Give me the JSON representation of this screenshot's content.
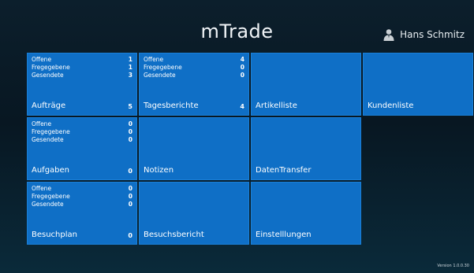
{
  "app": {
    "title": "mTrade",
    "version": "Version 1.0.0.30"
  },
  "user": {
    "name": "Hans Schmitz",
    "icon": "person-icon"
  },
  "tiles": [
    {
      "id": "auftraege",
      "label": "Aufträge",
      "count": "5",
      "stats": [
        {
          "label": "Offene",
          "value": "1"
        },
        {
          "label": "Fregegebene",
          "value": "1"
        },
        {
          "label": "Gesendete",
          "value": "3"
        }
      ]
    },
    {
      "id": "tagesberichte",
      "label": "Tagesberichte",
      "count": "4",
      "stats": [
        {
          "label": "Offene",
          "value": "4"
        },
        {
          "label": "Fregegebene",
          "value": "0"
        },
        {
          "label": "Gesendete",
          "value": "0"
        }
      ]
    },
    {
      "id": "artikelliste",
      "label": "Artikelliste"
    },
    {
      "id": "kundenliste",
      "label": "Kundenliste"
    },
    {
      "id": "aufgaben",
      "label": "Aufgaben",
      "count": "0",
      "stats": [
        {
          "label": "Offene",
          "value": "0"
        },
        {
          "label": "Fregegebene",
          "value": "0"
        },
        {
          "label": "Gesendete",
          "value": "0"
        }
      ]
    },
    {
      "id": "notizen",
      "label": "Notizen"
    },
    {
      "id": "datentransfer",
      "label": "DatenTransfer"
    },
    {
      "id": "besuchplan",
      "label": "Besuchplan",
      "count": "0",
      "stats": [
        {
          "label": "Offene",
          "value": "0"
        },
        {
          "label": "Fregegebene",
          "value": "0"
        },
        {
          "label": "Gesendete",
          "value": "0"
        }
      ]
    },
    {
      "id": "besuchsbericht",
      "label": "Besuchsbericht"
    },
    {
      "id": "einstellungen",
      "label": "Einstelllungen"
    }
  ],
  "colors": {
    "tile": "#0f6fc6",
    "background": "#0a1c28"
  }
}
